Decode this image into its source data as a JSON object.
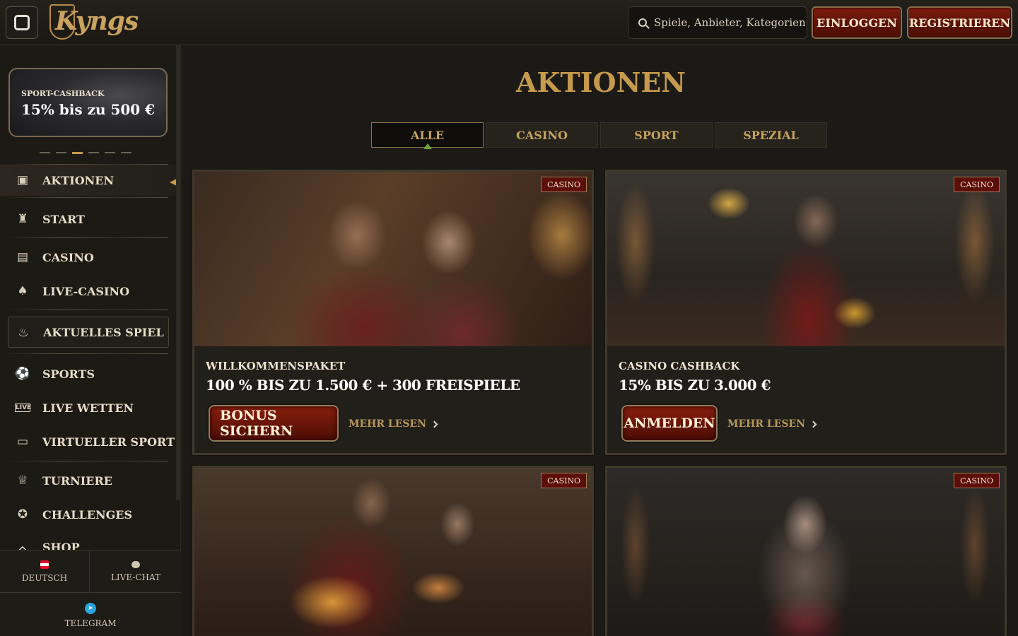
{
  "header": {
    "logo_text": "Kyngs",
    "search_placeholder": "Spiele, Anbieter, Kategorien",
    "login_label": "EINLOGGEN",
    "register_label": "REGISTRIEREN"
  },
  "sidebar": {
    "promo": {
      "label": "SPORT-CASHBACK",
      "text": "15% bis zu 500 €"
    },
    "carousel_dots": 6,
    "carousel_active": 2,
    "items": [
      {
        "label": "AKTIONEN",
        "icon": "gift-icon"
      },
      {
        "label": "START",
        "icon": "castle-icon"
      },
      {
        "label": "CASINO",
        "icon": "slot-machine-icon"
      },
      {
        "label": "LIVE-CASINO",
        "icon": "cards-icon"
      },
      {
        "label": "AKTUELLES SPIEL",
        "icon": "flame-icon"
      },
      {
        "label": "SPORTS",
        "icon": "soccer-ball-icon"
      },
      {
        "label": "LIVE WETTEN",
        "icon": "live-icon"
      },
      {
        "label": "VIRTUELLER SPORT",
        "icon": "monitor-ball-icon"
      },
      {
        "label": "TURNIERE",
        "icon": "trophy-icon"
      },
      {
        "label": "CHALLENGES",
        "icon": "medal-icon"
      },
      {
        "label": "SHOP",
        "icon": "shop-icon"
      }
    ],
    "bottom": {
      "language": "DEUTSCH",
      "chat": "LIVE-CHAT",
      "telegram": "TELEGRAM"
    }
  },
  "main": {
    "title": "AKTIONEN",
    "tabs": [
      "ALLE",
      "CASINO",
      "SPORT",
      "SPEZIAL"
    ],
    "active_tab": "ALLE",
    "cards": [
      {
        "badge": "CASINO",
        "subtitle": "WILLKOMMENSPAKET",
        "title": "100 % BIS ZU 1.500 € + 300 FREISPIELE",
        "cta": "BONUS SICHERN",
        "more": "MEHR LESEN"
      },
      {
        "badge": "CASINO",
        "subtitle": "CASINO CASHBACK",
        "title": "15% BIS ZU 3.000 €",
        "cta": "ANMELDEN",
        "more": "MEHR LESEN"
      },
      {
        "badge": "CASINO"
      },
      {
        "badge": "CASINO"
      }
    ]
  },
  "colors": {
    "background": "#1b1a16",
    "gold_accent": "#c69a4d",
    "button_red": "#7b1a0e",
    "active_indicator": "#6fa33a"
  }
}
